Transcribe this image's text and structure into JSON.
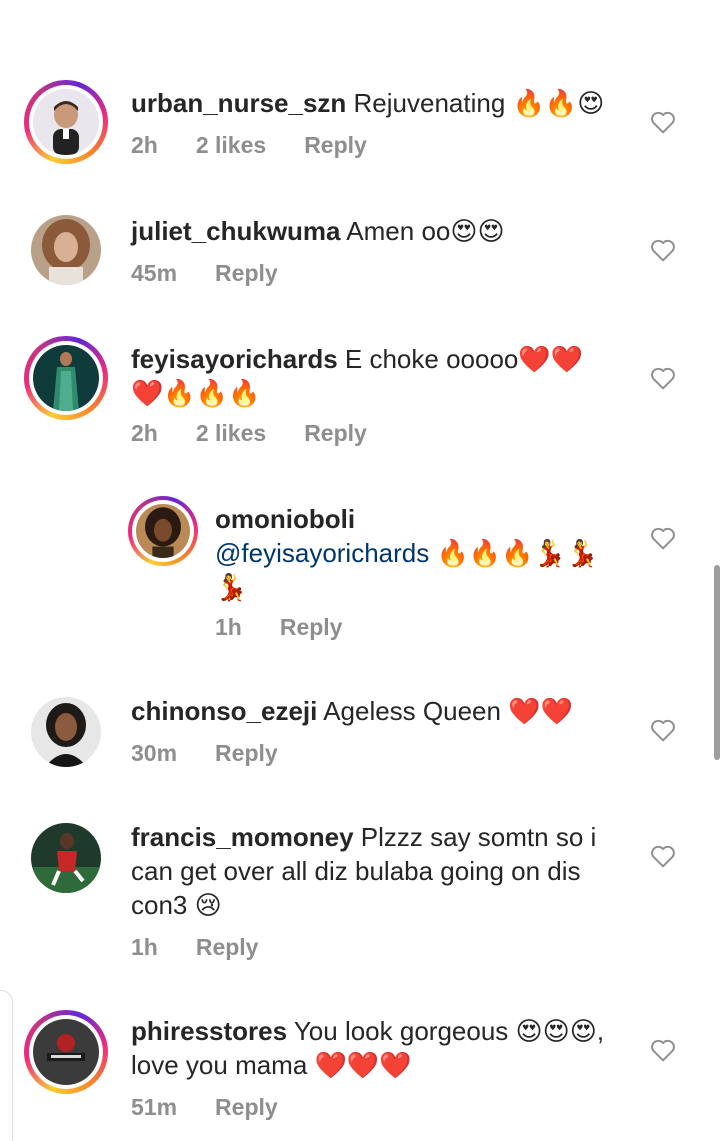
{
  "comments": [
    {
      "username": "urban_nurse_szn",
      "text": "Rejuvenating 🔥🔥😍",
      "time": "2h",
      "likes": "2 likes",
      "reply": "Reply",
      "avatar_ring": true,
      "avatar_icon": "cartoon-avatar"
    },
    {
      "username": "juliet_chukwuma",
      "text": "Amen oo😍😍",
      "time": "45m",
      "likes": "",
      "reply": "Reply",
      "avatar_ring": false,
      "avatar_icon": "user-photo"
    },
    {
      "username": "feyisayorichards",
      "text": "E choke ooooo❤️❤️❤️🔥🔥🔥",
      "time": "2h",
      "likes": "2 likes",
      "reply": "Reply",
      "avatar_ring": true,
      "avatar_icon": "user-photo"
    },
    {
      "username": "omonioboli",
      "mention": "@feyisayorichards",
      "text": "🔥🔥🔥💃💃💃",
      "time": "1h",
      "likes": "",
      "reply": "Reply",
      "avatar_ring": true,
      "avatar_icon": "user-photo"
    },
    {
      "username": "chinonso_ezeji",
      "text": "Ageless Queen ❤️❤️",
      "time": "30m",
      "likes": "",
      "reply": "Reply",
      "avatar_ring": false,
      "avatar_icon": "user-photo"
    },
    {
      "username": "francis_momoney",
      "text": "Plzzz say somtn so i can get over all diz bulaba going on dis con3 😢",
      "time": "1h",
      "likes": "",
      "reply": "Reply",
      "avatar_ring": false,
      "avatar_icon": "user-photo"
    },
    {
      "username": "phiresstores",
      "text": "You look gorgeous 😍😍😍, love you mama ❤️❤️❤️",
      "time": "51m",
      "likes": "",
      "reply": "Reply",
      "avatar_ring": true,
      "avatar_icon": "store-logo"
    }
  ],
  "colors": {
    "text": "#262626",
    "meta": "#8e8e8e",
    "mention": "#00376b",
    "heart_outline": "#8e8e8e"
  }
}
